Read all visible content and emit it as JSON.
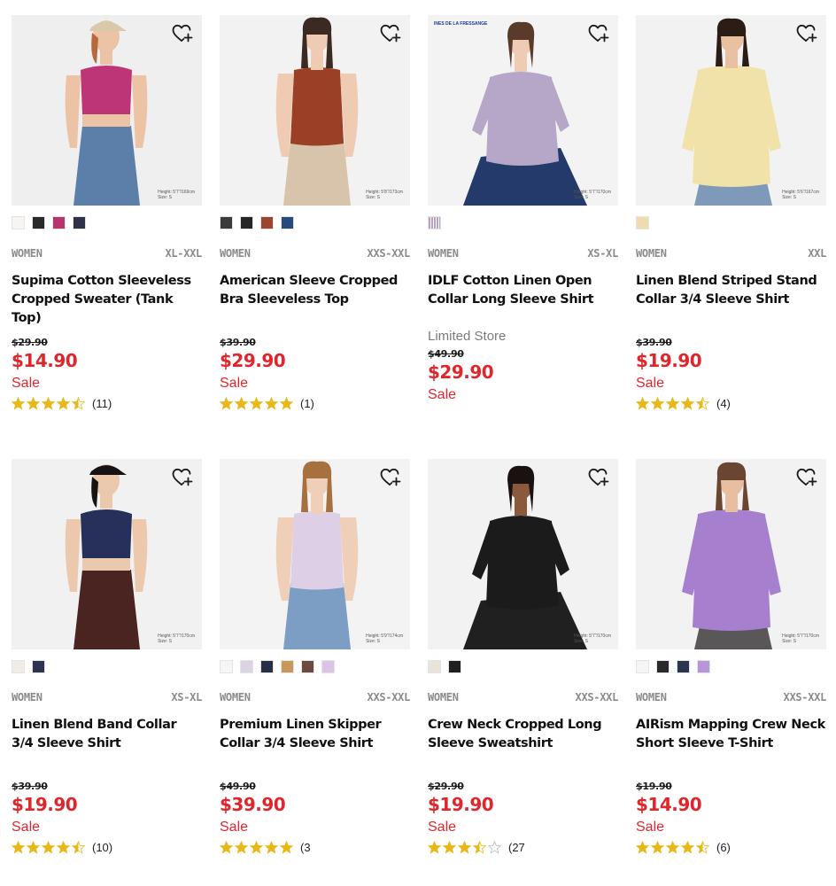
{
  "colors": {
    "accent_red": "#e0262c",
    "star_gold": "#e8b818",
    "muted": "#8a8a8a"
  },
  "products": [
    {
      "gender": "WOMEN",
      "sizes": "XL-XXL",
      "name": "Supima Cotton Sleeveless Cropped Sweater (Tank Top)",
      "original_price": "$29.90",
      "price": "$14.90",
      "sale": "Sale",
      "rating": 4.5,
      "reviews": "(11)",
      "model_info": [
        "Height: 5'7\"/169cm",
        "Size: S"
      ],
      "swatches": [
        "#f7f4f2",
        "#2a2a2a",
        "#b8346e",
        "#2f3348"
      ],
      "photo": {
        "bg": "#efefef",
        "top": "#bd3576",
        "bottom": "#5b7fa8",
        "skin": "#ecc3a5",
        "hair": "#b5693d",
        "hat": "#d9c9a8"
      },
      "favorite_icon": "heart-plus-icon"
    },
    {
      "gender": "WOMEN",
      "sizes": "XXS-XXL",
      "name": "American Sleeve Cropped Bra Sleeveless Top",
      "original_price": "$39.90",
      "price": "$29.90",
      "sale": "Sale",
      "rating": 5,
      "reviews": "(1)",
      "model_info": [
        "Height: 5'8\"/173cm",
        "Size: S"
      ],
      "swatches": [
        "#3b3b3b",
        "#262626",
        "#9c4430",
        "#244a7e"
      ],
      "photo": {
        "bg": "#f2f2f2",
        "top": "#9b3f26",
        "bottom": "#d8c4aa",
        "skin": "#eecbb2",
        "hair": "#3b2a22"
      },
      "favorite_icon": "heart-plus-icon"
    },
    {
      "gender": "WOMEN",
      "sizes": "XS-XL",
      "name": "IDLF Cotton Linen Open Collar Long Sleeve Shirt",
      "store_note": "Limited Store",
      "original_price": "$49.90",
      "price": "$29.90",
      "sale": "Sale",
      "model_info": [
        "Height: 5'7\"/170cm",
        "Size: S"
      ],
      "brand_label": "INES DE LA FRESSANGE",
      "swatches": [
        "#b9a3c4"
      ],
      "photo": {
        "bg": "#f3f3f3",
        "top": "#b6a6c8",
        "bottom": "#243a6b",
        "skin": "#eecbb2",
        "hair": "#5a3a2a"
      },
      "favorite_icon": "heart-plus-icon"
    },
    {
      "gender": "WOMEN",
      "sizes": "XXL",
      "name": "Linen Blend Striped Stand Collar 3/4 Sleeve Shirt",
      "original_price": "$39.90",
      "price": "$19.90",
      "sale": "Sale",
      "rating": 4.5,
      "reviews": "(4)",
      "model_info": [
        "Height: 5'6\"/167cm",
        "Size: S"
      ],
      "swatches": [
        "#eedcae"
      ],
      "photo": {
        "bg": "#f2f2f2",
        "top": "#f0e2a8",
        "bottom": "#7f9ab8",
        "skin": "#e9c0a0",
        "hair": "#2b1c15"
      },
      "favorite_icon": "heart-plus-icon"
    },
    {
      "gender": "WOMEN",
      "sizes": "XS-XL",
      "name": "Linen Blend Band Collar 3/4 Sleeve Shirt",
      "original_price": "$39.90",
      "price": "$19.90",
      "sale": "Sale",
      "rating": 4.5,
      "reviews": "(10)",
      "model_info": [
        "Height: 5'7\"/170cm",
        "Size: S"
      ],
      "swatches": [
        "#f2ece6",
        "#2d3350"
      ],
      "photo": {
        "bg": "#f1f1f1",
        "top": "#27305a",
        "bottom": "#4a2420",
        "skin": "#ecc8ad",
        "hair": "#171312"
      },
      "favorite_icon": "heart-plus-icon"
    },
    {
      "gender": "WOMEN",
      "sizes": "XXS-XXL",
      "name": "Premium Linen Skipper Collar 3/4 Sleeve Shirt",
      "original_price": "$49.90",
      "price": "$39.90",
      "sale": "Sale",
      "rating": 5,
      "reviews": "(3",
      "model_info": [
        "Height: 5'9\"/174cm",
        "Size: S"
      ],
      "swatches": [
        "#f6f6f6",
        "#ddd2e2",
        "#2b2f45",
        "#c8975a",
        "#6e4a3e",
        "#dcc2e6"
      ],
      "photo": {
        "bg": "#f3f3f3",
        "top": "#ddd0e6",
        "bottom": "#7d9ec4",
        "skin": "#efcfb8",
        "hair": "#a7713f"
      },
      "favorite_icon": "heart-plus-icon"
    },
    {
      "gender": "WOMEN",
      "sizes": "XXS-XXL",
      "name": "Crew Neck Cropped Long Sleeve Sweatshirt",
      "original_price": "$29.90",
      "price": "$19.90",
      "sale": "Sale",
      "rating": 3.5,
      "reviews": "(27",
      "model_info": [
        "Height: 5'7\"/170cm",
        "Size: S"
      ],
      "swatches": [
        "#ebe3da",
        "#1f1f1f"
      ],
      "photo": {
        "bg": "#f2f2f2",
        "top": "#1b1b1b",
        "bottom": "#202020",
        "skin": "#8b5a3c",
        "hair": "#1a1210"
      },
      "favorite_icon": "heart-plus-icon"
    },
    {
      "gender": "WOMEN",
      "sizes": "XXS-XXL",
      "name": "AIRism Mapping Crew Neck Short Sleeve T-Shirt",
      "original_price": "$19.90",
      "price": "$14.90",
      "sale": "Sale",
      "rating": 4.5,
      "reviews": "(6)",
      "model_info": [
        "Height: 5'7\"/170cm",
        "Size: S"
      ],
      "swatches": [
        "#f5f5f5",
        "#2a2a2a",
        "#2c3550",
        "#b795d6"
      ],
      "photo": {
        "bg": "#f2f2f2",
        "top": "#a67fcf",
        "bottom": "#595757",
        "skin": "#e7bea0",
        "hair": "#6a4632"
      },
      "favorite_icon": "heart-plus-icon"
    }
  ]
}
